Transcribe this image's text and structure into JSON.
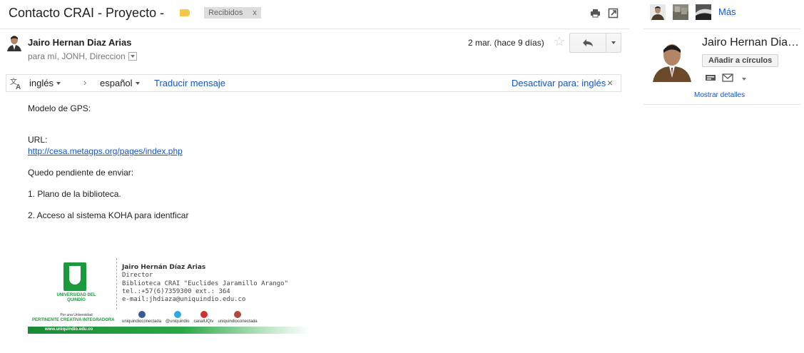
{
  "thread": {
    "subject": "Contacto CRAI - Proyecto -",
    "label": "Recibidos",
    "label_remove": "x",
    "print_icon": "printer-icon",
    "newwindow_icon": "new-window-icon"
  },
  "message": {
    "sender_name": "Jairo Hernan Diaz Arias",
    "recipients": "para mí, JONH, Direccion",
    "date": "2 mar. (hace 9 días)",
    "star": "☆"
  },
  "translate": {
    "source_lang": "inglés",
    "arrow": "›",
    "target_lang": "español",
    "translate_link": "Traducir mensaje",
    "disable_label": "Desactivar para: inglés",
    "close": "×"
  },
  "body": {
    "line1": "Modelo de GPS:",
    "url_label": "URL:",
    "url": "http://cesa.metagps.org/pages/index.php",
    "pending": "Quedo pendiente de enviar:",
    "item1": "1. Plano de la biblioteca.",
    "item2": "2. Acceso al sistema KOHA para identficar"
  },
  "signature": {
    "university": "UNIVERSIDAD DEL QUINDÍO",
    "tagline_small": "Por una Universidad",
    "tagline": "PERTINENTE CREATIVA INTEGRADORA",
    "name": "Jairo Hernán Díaz Arias",
    "title": "Director",
    "library": "Biblioteca CRAI \"Euclides Jaramillo Arango\"",
    "phone": "tel.:+57(6)7359300  ext.: 364",
    "email": "e-mail:jhdiaza@uniquindio.edu.co",
    "website": "www.uniquindio.edu.co",
    "socials": [
      {
        "icon": "facebook-icon",
        "label": "uniquindioconectada",
        "color": "#3b5998"
      },
      {
        "icon": "twitter-icon",
        "label": "@uniquindio",
        "color": "#2fa9e0"
      },
      {
        "icon": "youtube-icon",
        "label": "canalUQtv",
        "color": "#d0312d"
      },
      {
        "icon": "instagram-icon",
        "label": "uniquindioconectada",
        "color": "#b04a3a"
      }
    ]
  },
  "sidebar": {
    "more_link": "Más",
    "contact_name": "Jairo Hernan Dia…",
    "add_circles": "Añadir a círculos",
    "show_details": "Mostrar detalles"
  },
  "colors": {
    "link": "#1155cc",
    "label_bg": "#dddddd",
    "tag_yellow": "#f6c644",
    "university_green": "#1a9a3c"
  }
}
